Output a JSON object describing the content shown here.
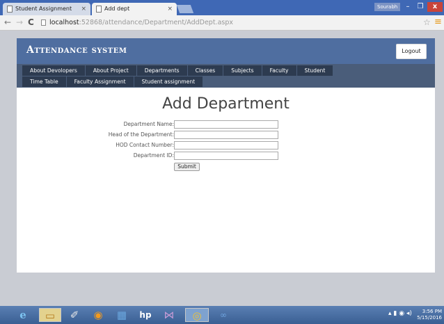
{
  "browser": {
    "tabs": [
      {
        "label": "Student Assignment",
        "close": "×"
      },
      {
        "label": "Add dept",
        "close": "×"
      }
    ],
    "user": "Sourabh",
    "window_controls": {
      "minimize": "–",
      "maximize": "❐",
      "close": "x"
    },
    "nav": {
      "back": "←",
      "forward": "→",
      "reload": "C"
    },
    "address": {
      "host": "localhost",
      "rest": ":52868/attendance/Department/AddDept.aspx"
    },
    "star": "☆",
    "menu": "≡"
  },
  "app": {
    "title": "Attendance system",
    "logout": "Logout",
    "menu": [
      "About Devolopers",
      "About Project",
      "Departments",
      "Classes",
      "Subjects",
      "Faculty",
      "Student",
      "Time Table",
      "Faculty Assignment",
      "Student assignment"
    ]
  },
  "form": {
    "heading": "Add Department",
    "fields": [
      {
        "label": "Department Name:",
        "value": ""
      },
      {
        "label": "Head of the Department:",
        "value": ""
      },
      {
        "label": "HOD Contact Number:",
        "value": ""
      },
      {
        "label": "Department ID:",
        "value": ""
      }
    ],
    "submit": "Submit"
  },
  "taskbar": {
    "apps": {
      "ie": "e",
      "explorer": "▭",
      "vs": "✐",
      "firefox": "◉",
      "media": "▦",
      "hp": "hp",
      "vsc": "⋈",
      "chrome": "◎",
      "cloud": "∞"
    },
    "tray": "▴ ▮ ◉ ◂)",
    "time": "3:56 PM",
    "date": "5/15/2016"
  },
  "colors": {
    "header": "#4f6ea0",
    "menu_bg": "#2d3b50",
    "navbar": "#4a5d7a",
    "tab_strip": "#3f68b5"
  }
}
